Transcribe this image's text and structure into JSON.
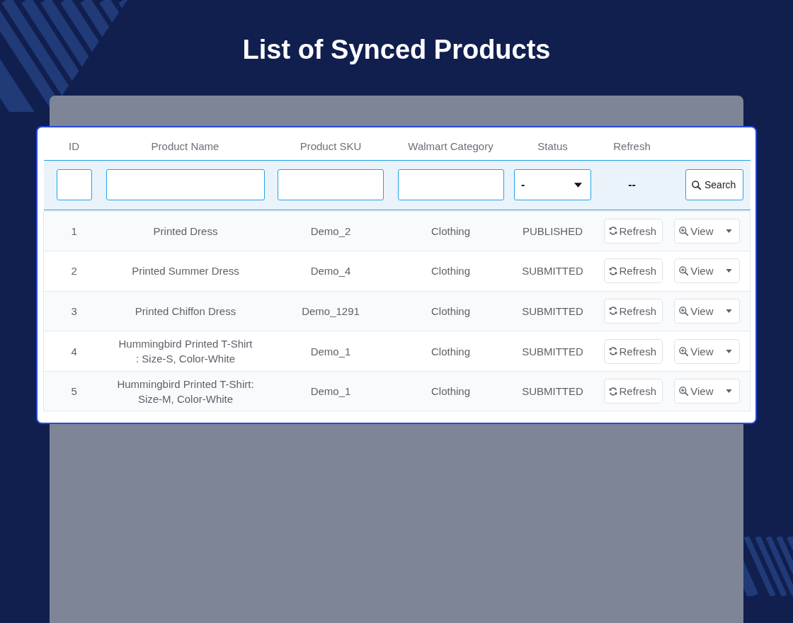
{
  "title": "List of Synced Products",
  "table": {
    "columns": [
      "ID",
      "Product Name",
      "Product SKU",
      "Walmart Category",
      "Status",
      "Refresh"
    ],
    "filters": [
      {
        "kind": "text"
      },
      {
        "kind": "text"
      },
      {
        "kind": "text"
      },
      {
        "kind": "text"
      },
      {
        "kind": "select",
        "value": "-"
      },
      {
        "kind": "label",
        "text": "--"
      },
      {
        "kind": "button",
        "label": "Search"
      }
    ],
    "rows": [
      {
        "id": "1",
        "product_name": "Printed Dress",
        "product_sku": "Demo_2",
        "walmart_category": "Clothing",
        "status": "PUBLISHED",
        "refresh_button": "Refresh",
        "view_button": "View"
      },
      {
        "id": "2",
        "product_name": "Printed Summer Dress",
        "product_sku": "Demo_4",
        "walmart_category": "Clothing",
        "status": "SUBMITTED",
        "refresh_button": "Refresh",
        "view_button": "View"
      },
      {
        "id": "3",
        "product_name": "Printed Chiffon Dress",
        "product_sku": "Demo_1291",
        "walmart_category": "Clothing",
        "status": "SUBMITTED",
        "refresh_button": "Refresh",
        "view_button": "View"
      },
      {
        "id": "4",
        "product_name": "Hummingbird Printed T-Shirt : Size-S, Color-White",
        "product_sku": "Demo_1",
        "walmart_category": "Clothing",
        "status": "SUBMITTED",
        "refresh_button": "Refresh",
        "view_button": "View"
      },
      {
        "id": "5",
        "product_name": "Hummingbird Printed T-Shirt: Size-M, Color-White",
        "product_sku": "Demo_1",
        "walmart_category": "Clothing",
        "status": "SUBMITTED",
        "refresh_button": "Refresh",
        "view_button": "View"
      }
    ]
  }
}
